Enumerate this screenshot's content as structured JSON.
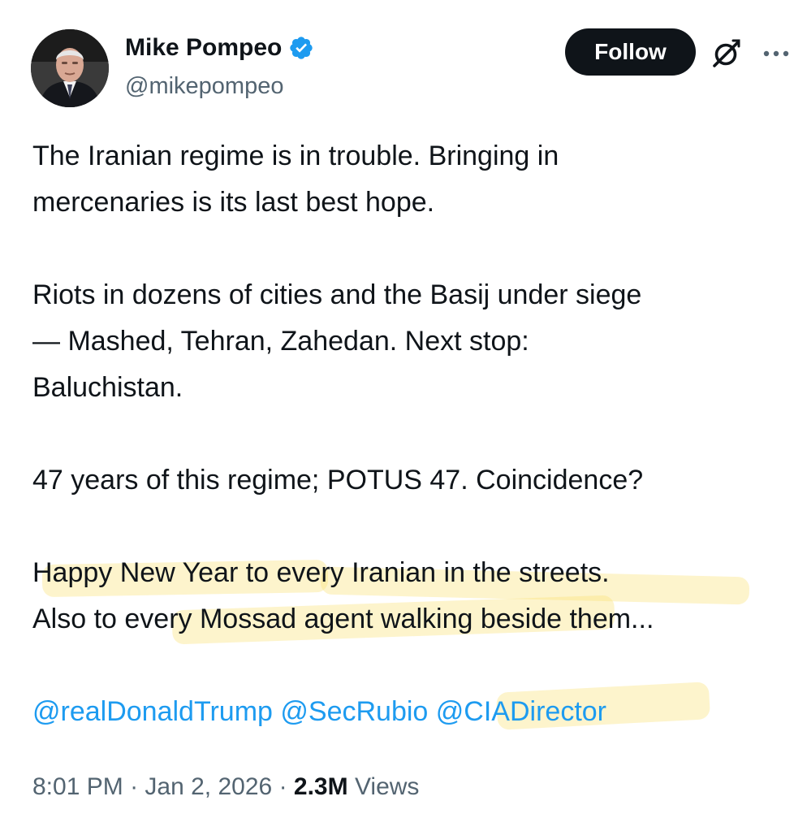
{
  "author": {
    "name": "Mike Pompeo",
    "handle": "@mikepompeo",
    "verified": true,
    "verified_color": "#1d9bf0",
    "avatar_icon": "profile-photo"
  },
  "actions": {
    "follow_label": "Follow",
    "grok_icon": "grok-icon",
    "more_icon": "more-icon"
  },
  "tweet": {
    "lines": [
      "The Iranian regime is in trouble. Bringing in",
      "mercenaries is its last best hope.",
      "",
      "Riots in dozens of cities and the Basij under siege",
      "— Mashed, Tehran, Zahedan.  Next stop:",
      "Baluchistan.",
      "",
      "47 years of this regime; POTUS 47.  Coincidence?",
      "",
      "Happy New Year to every Iranian in the streets.",
      "Also to every Mossad agent walking beside them..."
    ],
    "mentions": [
      "@realDonaldTrump",
      "@SecRubio",
      "@CIADirector"
    ],
    "mention_color": "#1d9bf0",
    "highlight_color": "#fae178"
  },
  "meta": {
    "time": "8:01 PM",
    "separator": "·",
    "date": "Jan 2, 2026",
    "views_count": "2.3M",
    "views_label": "Views"
  }
}
